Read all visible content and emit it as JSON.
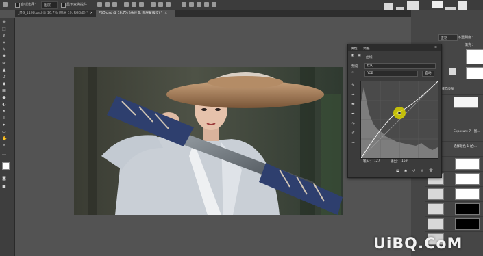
{
  "options_bar": {
    "auto_select_label": "自动选择：",
    "auto_select_value": "图层",
    "show_transform_label": "显示变换控件"
  },
  "tabs": [
    {
      "label": "_MG_1108.psd @ 16.7% (图层 10, RGB/8) *",
      "close": "×",
      "active": false
    },
    {
      "label": "PSD.psd @ 16.7% (曲线 6, 图层蒙版/8) *",
      "close": "×",
      "active": true
    }
  ],
  "tools": [
    "move-tool",
    "marquee-tool",
    "lasso-tool",
    "crop-tool",
    "eyedropper-tool",
    "healing-tool",
    "brush-tool",
    "stamp-tool",
    "history-brush-tool",
    "eraser-tool",
    "gradient-tool",
    "blur-tool",
    "dodge-tool",
    "pen-tool",
    "type-tool",
    "path-select-tool",
    "shape-tool",
    "hand-tool",
    "zoom-tool",
    "more-tools",
    "swap-colors",
    "foreground-color",
    "background-color",
    "quick-mask",
    "screen-mode"
  ],
  "layers_dock": {
    "blend_mode": "正常",
    "opacity_label": "不透明度：",
    "fill_label": "填充：",
    "layer_names": [
      "细节加强",
      "Exposure 7 - 图...",
      "选择颜色 1 (合..."
    ]
  },
  "properties_panel": {
    "tab_properties": "属性",
    "tab_adjustments": "调整",
    "adjustment_title": "曲线",
    "preset_label": "预设",
    "preset_value": "默认",
    "channel_value": "RGB",
    "auto_button": "自动",
    "input_label": "输入：",
    "input_value": "127",
    "output_label": "输出：",
    "output_value": "159"
  },
  "watermark": "UiBQ.CoM",
  "colors": {
    "ui_dark": "#3b3b3b",
    "ui_mid": "#535353",
    "curve_point": "#d8d200",
    "sword_wrap": "#2e3f6e"
  }
}
